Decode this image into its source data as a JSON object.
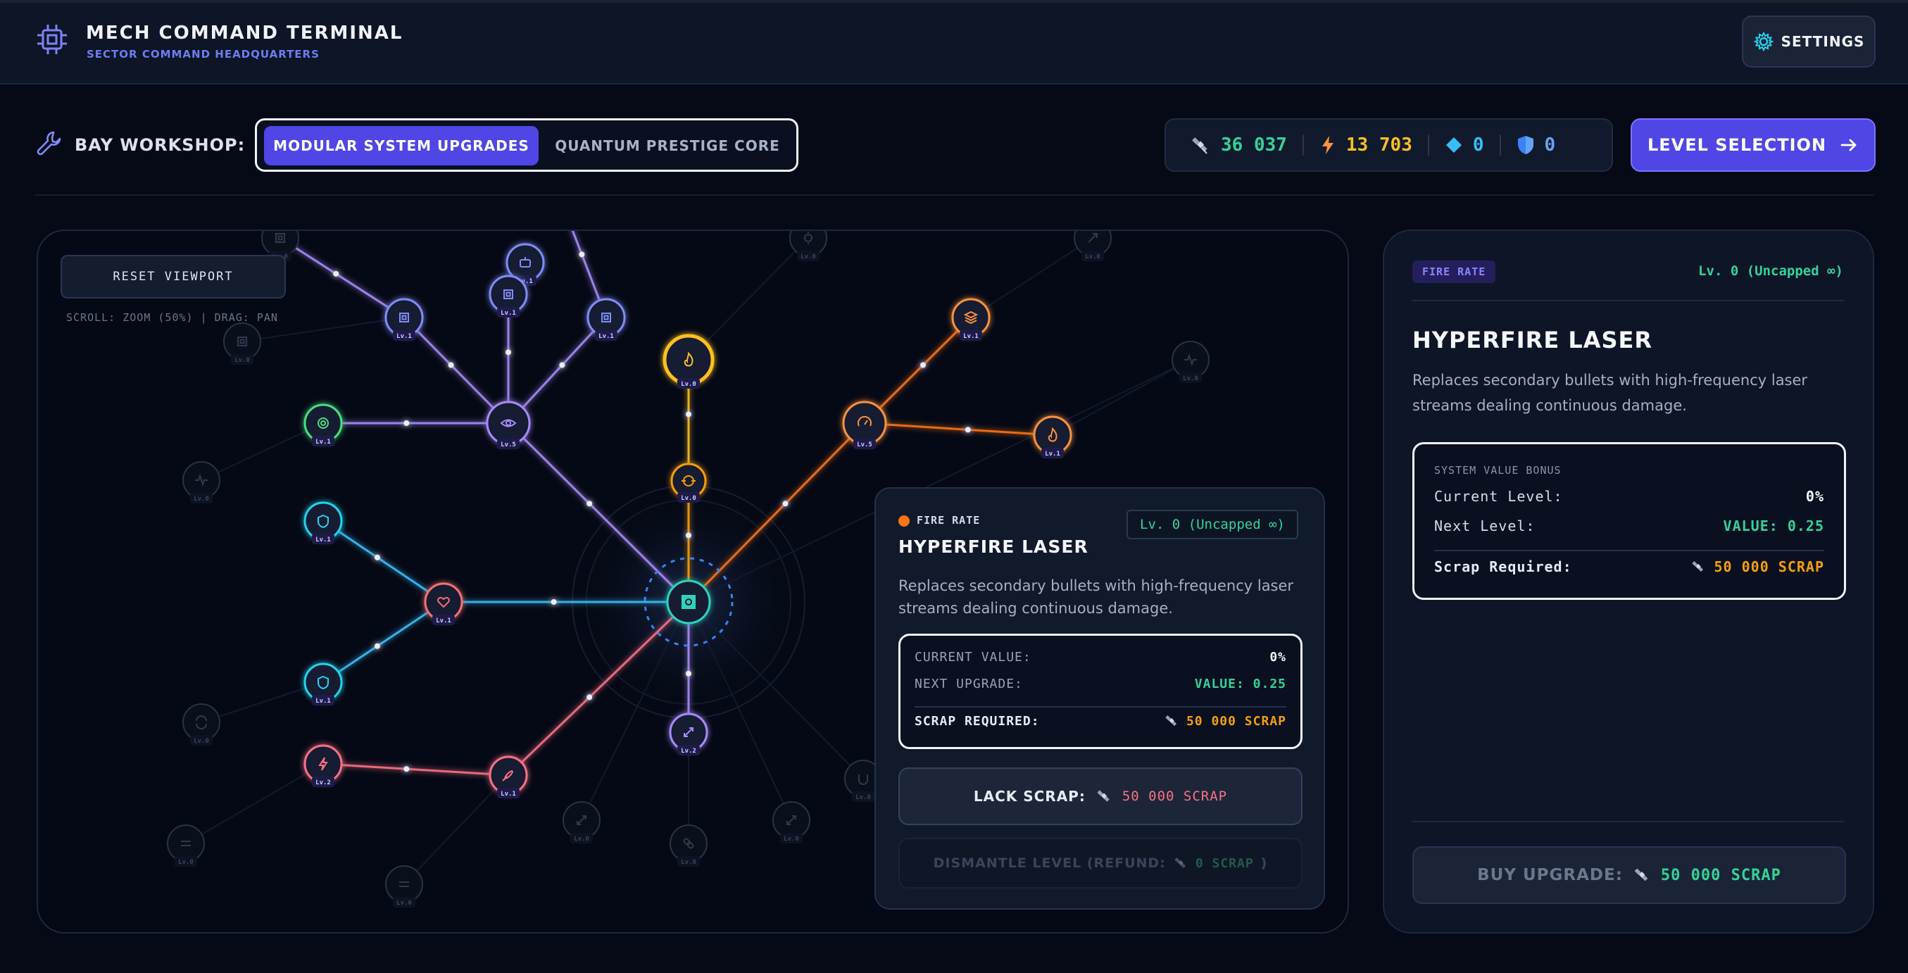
{
  "header": {
    "title": "MECH COMMAND TERMINAL",
    "subtitle": "SECTOR COMMAND HEADQUARTERS",
    "settings_label": "SETTINGS",
    "chip_icon": "cpu-chip-icon"
  },
  "toolbar": {
    "bay_label": "BAY WORKSHOP:",
    "tabs": [
      {
        "label": "MODULAR SYSTEM UPGRADES",
        "active": true
      },
      {
        "label": "QUANTUM PRESTIGE CORE",
        "active": false
      }
    ],
    "resources": [
      {
        "name": "scrap",
        "icon": "satellite-icon",
        "value": "36 037",
        "color": "#34d399"
      },
      {
        "name": "energy",
        "icon": "lightning-icon",
        "value": "13 703",
        "color": "#fbbf24"
      },
      {
        "name": "crystals",
        "icon": "diamond-icon",
        "value": "0",
        "color": "#38bdf8"
      },
      {
        "name": "shields",
        "icon": "shield-icon",
        "value": "0",
        "color": "#60a5fa"
      }
    ],
    "level_selection_label": "LEVEL SELECTION"
  },
  "tree": {
    "reset_label": "RESET VIEWPORT",
    "hint": "SCROLL: ZOOM (50%) | DRAG: PAN",
    "nodes": [
      {
        "id": "core",
        "icon": "core-icon",
        "level": "",
        "color": "#2dd4bf",
        "state": "core"
      },
      {
        "id": "fire-main",
        "icon": "flame-icon",
        "level": "Lv.0",
        "color": "#fbbf24",
        "state": "selected"
      },
      {
        "id": "fire-sub",
        "icon": "crosshair-icon",
        "level": "Lv.0",
        "color": "#f59e0b",
        "state": "active"
      },
      {
        "id": "eye",
        "icon": "eye-icon",
        "level": "Lv.5",
        "color": "#a78bfa",
        "state": "active"
      },
      {
        "id": "cpu-a",
        "icon": "cpu-icon",
        "level": "Lv.1",
        "color": "#818cf8",
        "state": "active"
      },
      {
        "id": "bot-a",
        "icon": "robot-icon",
        "level": "Lv.1",
        "color": "#818cf8",
        "state": "active"
      },
      {
        "id": "cpu-b",
        "icon": "cpu-icon",
        "level": "Lv.1",
        "color": "#818cf8",
        "state": "active"
      },
      {
        "id": "cpu-c",
        "icon": "cpu-icon",
        "level": "Lv.1",
        "color": "#818cf8",
        "state": "active"
      },
      {
        "id": "bot-b",
        "icon": "robot-icon",
        "level": "Lv.2",
        "color": "#4ade80",
        "state": "active"
      },
      {
        "id": "target",
        "icon": "target-icon",
        "level": "Lv.1",
        "color": "#4ade80",
        "state": "active"
      },
      {
        "id": "heart",
        "icon": "heart-icon",
        "level": "Lv.1",
        "color": "#f87171",
        "state": "active"
      },
      {
        "id": "shield-a",
        "icon": "shield-icon",
        "level": "Lv.1",
        "color": "#22d3ee",
        "state": "active"
      },
      {
        "id": "shield-b",
        "icon": "shield-icon",
        "level": "Lv.1",
        "color": "#22d3ee",
        "state": "active"
      },
      {
        "id": "bolt",
        "icon": "lightning-icon",
        "level": "Lv.2",
        "color": "#fb7185",
        "state": "active"
      },
      {
        "id": "rocket",
        "icon": "rocket-icon",
        "level": "Lv.1",
        "color": "#fb7185",
        "state": "active"
      },
      {
        "id": "gauge",
        "icon": "gauge-icon",
        "level": "Lv.5",
        "color": "#fb923c",
        "state": "active"
      },
      {
        "id": "layers",
        "icon": "layers-icon",
        "level": "Lv.1",
        "color": "#fb923c",
        "state": "active"
      },
      {
        "id": "flame-b",
        "icon": "flame-icon",
        "level": "Lv.1",
        "color": "#fb923c",
        "state": "active"
      },
      {
        "id": "expand",
        "icon": "expand-icon",
        "level": "Lv.2",
        "color": "#a78bfa",
        "state": "active"
      },
      {
        "id": "cpu-locked",
        "icon": "cpu-icon",
        "level": "Lv.0",
        "color": "#818cf8",
        "state": "locked"
      },
      {
        "id": "pulse-a",
        "icon": "pulse-icon",
        "level": "Lv.0",
        "color": "#4ade80",
        "state": "locked"
      },
      {
        "id": "pulse-b",
        "icon": "pulse-icon",
        "level": "Lv.0",
        "color": "#f87171",
        "state": "locked"
      },
      {
        "id": "refresh",
        "icon": "refresh-icon",
        "level": "Lv.0",
        "color": "#4ade80",
        "state": "locked"
      },
      {
        "id": "arrows-a",
        "icon": "arrows-icon",
        "level": "Lv.0",
        "color": "#60a5fa",
        "state": "locked"
      },
      {
        "id": "arrows-b",
        "icon": "arrows-icon",
        "level": "Lv.0",
        "color": "#fb7185",
        "state": "locked"
      },
      {
        "id": "expand-b",
        "icon": "expand-icon",
        "level": "Lv.0",
        "color": "#818cf8",
        "state": "locked"
      },
      {
        "id": "link",
        "icon": "link-icon",
        "level": "Lv.0",
        "color": "#a3e635",
        "state": "locked"
      },
      {
        "id": "expand-c",
        "icon": "expand-icon",
        "level": "Lv.0",
        "color": "#a78bfa",
        "state": "locked"
      },
      {
        "id": "magnet",
        "icon": "magnet-icon",
        "level": "Lv.0",
        "color": "#4ade80",
        "state": "locked"
      },
      {
        "id": "top-a",
        "icon": "cpu-icon",
        "level": "Lv.0",
        "color": "#818cf8",
        "state": "locked"
      },
      {
        "id": "top-b",
        "icon": "sun-icon",
        "level": "Lv.0",
        "color": "#fbbf24",
        "state": "locked"
      },
      {
        "id": "top-c",
        "icon": "arrow-up-right-icon",
        "level": "Lv.0",
        "color": "#fb923c",
        "state": "locked"
      }
    ]
  },
  "popup": {
    "category": "FIRE RATE",
    "level": "Lv. 0 (Uncapped ∞)",
    "title": "HYPERFIRE LASER",
    "description": "Replaces secondary bullets with high-frequency laser streams dealing continuous damage.",
    "current_label": "CURRENT VALUE:",
    "current_value": "0%",
    "next_label": "NEXT UPGRADE:",
    "next_value": "VALUE: 0.25",
    "scrap_label": "SCRAP REQUIRED:",
    "scrap_value": "50 000 SCRAP",
    "lack_label": "LACK SCRAP:",
    "lack_value": "50 000 SCRAP",
    "dismantle_label": "DISMANTLE LEVEL (REFUND:",
    "dismantle_value": "0 SCRAP",
    "dismantle_close": ")"
  },
  "detail": {
    "badge": "FIRE RATE",
    "level": "Lv. 0 (Uncapped ∞)",
    "title": "HYPERFIRE LASER",
    "description": "Replaces secondary bullets with high-frequency laser streams dealing continuous damage.",
    "stats_title": "SYSTEM VALUE BONUS",
    "current_label": "Current Level:",
    "current_value": "0%",
    "next_label": "Next Level:",
    "next_value": "VALUE: 0.25",
    "scrap_label": "Scrap Required:",
    "scrap_value": "50 000 SCRAP",
    "buy_label": "BUY UPGRADE:",
    "buy_value": "50 000 SCRAP"
  },
  "colors": {
    "accent": "#4f46e5",
    "green": "#34d399",
    "orange": "#f59e0b",
    "red": "#fb7185"
  }
}
